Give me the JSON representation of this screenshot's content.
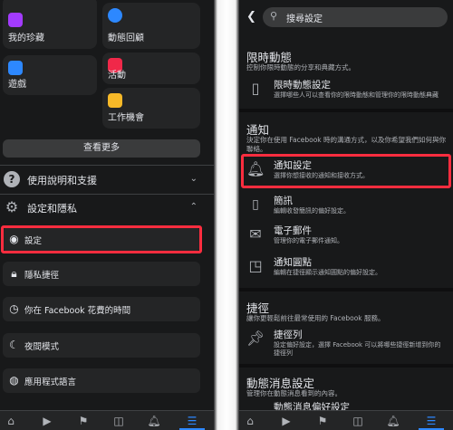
{
  "left": {
    "shortcut_cards": [
      {
        "label": "我的珍藏",
        "icon": "bookmark-icon",
        "color": "#a33bff"
      },
      {
        "label": "動態回顧",
        "icon": "clock-icon",
        "color": "#2d88ff"
      },
      {
        "label": "遊戲",
        "icon": "gaming-icon",
        "color": "#2d88ff"
      },
      {
        "label": "活動",
        "icon": "calendar-icon",
        "color": "#f02849"
      },
      {
        "label": "工作機會",
        "icon": "briefcase-icon",
        "color": "#f7b928"
      }
    ],
    "see_more": "查看更多",
    "help_section": "使用說明和支援",
    "settings_section": "設定和隱私",
    "menu": [
      {
        "label": "設定",
        "icon": "user-gear-icon"
      },
      {
        "label": "隱私捷徑",
        "icon": "lock-icon"
      },
      {
        "label": "你在 Facebook 花費的時間",
        "icon": "clock-icon"
      },
      {
        "label": "夜間模式",
        "icon": "moon-icon"
      },
      {
        "label": "應用程式語言",
        "icon": "globe-icon"
      }
    ]
  },
  "right": {
    "search_placeholder": "搜尋設定",
    "stories": {
      "heading": "限時動態",
      "desc": "控制你限時動態的分享和典藏方式。",
      "item_title": "限時動態設定",
      "item_sub": "選擇哪些人可以查看你的限時動態和管理你的限時動態典藏"
    },
    "notifications": {
      "heading": "通知",
      "desc": "決定你在使用 Facebook 時的溝通方式，以及你希望我們如何與你聯絡。",
      "items": [
        {
          "title": "通知設定",
          "sub": "選擇你想接收的通知和接收方式。",
          "icon": "bell-icon"
        },
        {
          "title": "簡訊",
          "sub": "編輯收發簡訊的偏好設定。",
          "icon": "phone-icon"
        },
        {
          "title": "電子郵件",
          "sub": "管理你的電子郵件通知。",
          "icon": "envelope-icon"
        },
        {
          "title": "通知圓點",
          "sub": "編輯在捷徑顯示通知圓點的偏好設定。",
          "icon": "badge-icon"
        }
      ]
    },
    "shortcuts": {
      "heading": "捷徑",
      "desc": "讓你更輕鬆前往最常使用的 Facebook 服務。",
      "item_title": "捷徑列",
      "item_sub1": "設定偏好設定，選擇 Facebook 可以將哪些捷徑新增到你的",
      "item_sub2": "捷徑列"
    },
    "newsfeed": {
      "heading": "動態消息設定",
      "desc": "管理你在動態消息看到的內容。",
      "partial": "動態消息偏好設定"
    }
  }
}
